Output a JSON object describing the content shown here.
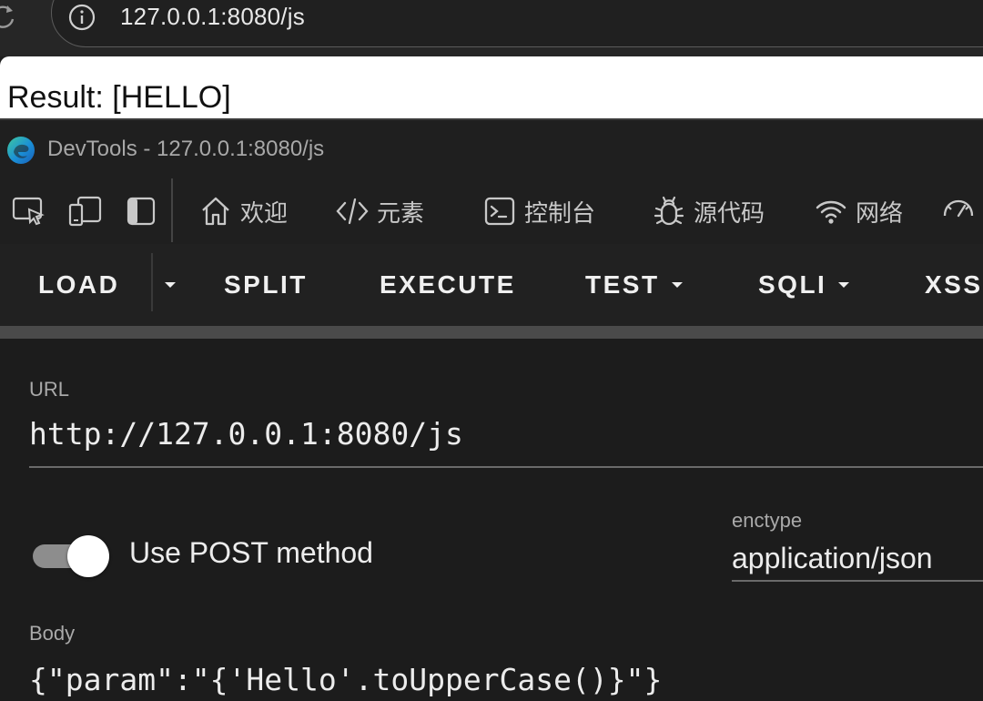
{
  "browser": {
    "address": "127.0.0.1:8080/js"
  },
  "page": {
    "result_text": "Result: [HELLO]"
  },
  "devtools": {
    "title": "DevTools - 127.0.0.1:8080/js",
    "tabs": [
      {
        "label": "欢迎",
        "icon": "home-icon"
      },
      {
        "label": "元素",
        "icon": "code-icon"
      },
      {
        "label": "控制台",
        "icon": "console-icon"
      },
      {
        "label": "源代码",
        "icon": "bug-icon"
      },
      {
        "label": "网络",
        "icon": "wifi-icon"
      },
      {
        "label": "",
        "icon": "performance-icon"
      }
    ]
  },
  "hackbar": {
    "buttons": {
      "load": "LOAD",
      "split": "SPLIT",
      "execute": "EXECUTE",
      "test": "TEST",
      "sqli": "SQLI",
      "xss": "XSS"
    },
    "url_label": "URL",
    "url_value": "http://127.0.0.1:8080/js",
    "post_toggle_label": "Use POST method",
    "post_toggle_on": true,
    "enctype_label": "enctype",
    "enctype_value": "application/json",
    "body_label": "Body",
    "body_value": "{\"param\":\"{'Hello'.toUpperCase()}\"}"
  },
  "colors": {
    "devtools_bg": "#1f1f1f",
    "text_primary": "#ececec",
    "label": "#a9a9a9"
  }
}
